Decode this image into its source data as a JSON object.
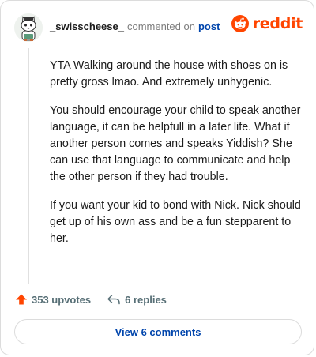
{
  "header": {
    "username": "_swisscheese_",
    "commented_on": "commented on",
    "post_link": "post",
    "brand": "reddit",
    "brand_color": "#ff4500",
    "avatar_icon": "cat-snoo-avatar-icon"
  },
  "comment": {
    "paragraphs": [
      "YTA Walking around the house with shoes on is pretty gross lmao. And extremely unhygenic.",
      "You should encourage your child to speak another language, it can be helpfull in a later life. What if another person comes and speaks Yiddish? She can use that language to communicate and help the other person if they had trouble.",
      "If you want your kid to bond with Nick. Nick should get up of his own ass and be a fun stepparent to her."
    ]
  },
  "actions": {
    "upvotes": "353 upvotes",
    "upvote_icon": "upvote-arrow-icon",
    "upvote_color": "#ff4500",
    "replies": "6 replies",
    "reply_icon": "reply-arrow-icon"
  },
  "footer": {
    "view_comments": "View 6 comments",
    "link_color": "#0045ac"
  }
}
